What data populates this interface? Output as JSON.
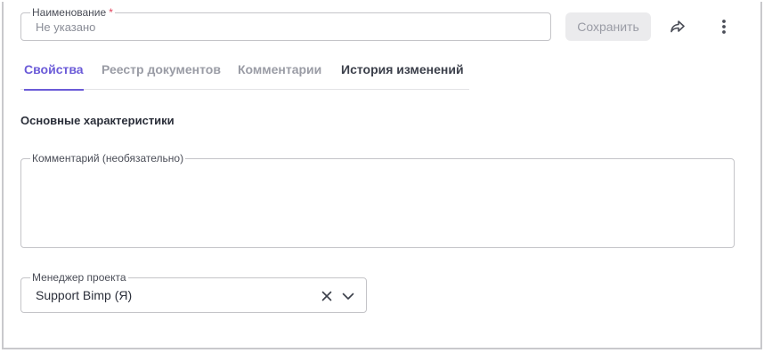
{
  "header": {
    "name_field": {
      "label": "Наименование",
      "required_mark": "*",
      "placeholder": "Не указано"
    },
    "save_label": "Сохранить",
    "share_icon": "share-icon",
    "more_icon": "more-vertical-icon"
  },
  "tabs": [
    {
      "label": "Свойства",
      "active": true
    },
    {
      "label": "Реестр документов",
      "active": false
    },
    {
      "label": "Комментарии",
      "active": false
    },
    {
      "label": "История изменений",
      "active": false
    }
  ],
  "main": {
    "section_title": "Основные характеристики",
    "comment_field": {
      "label": "Комментарий (необязательно)",
      "value": ""
    },
    "manager_field": {
      "label": "Менеджер проекта",
      "value": "Support Bimp (Я)"
    }
  },
  "colors": {
    "accent": "#6b5bd8",
    "required": "#e0405a",
    "muted": "#9a9ca5",
    "border": "#c4c4c8"
  }
}
